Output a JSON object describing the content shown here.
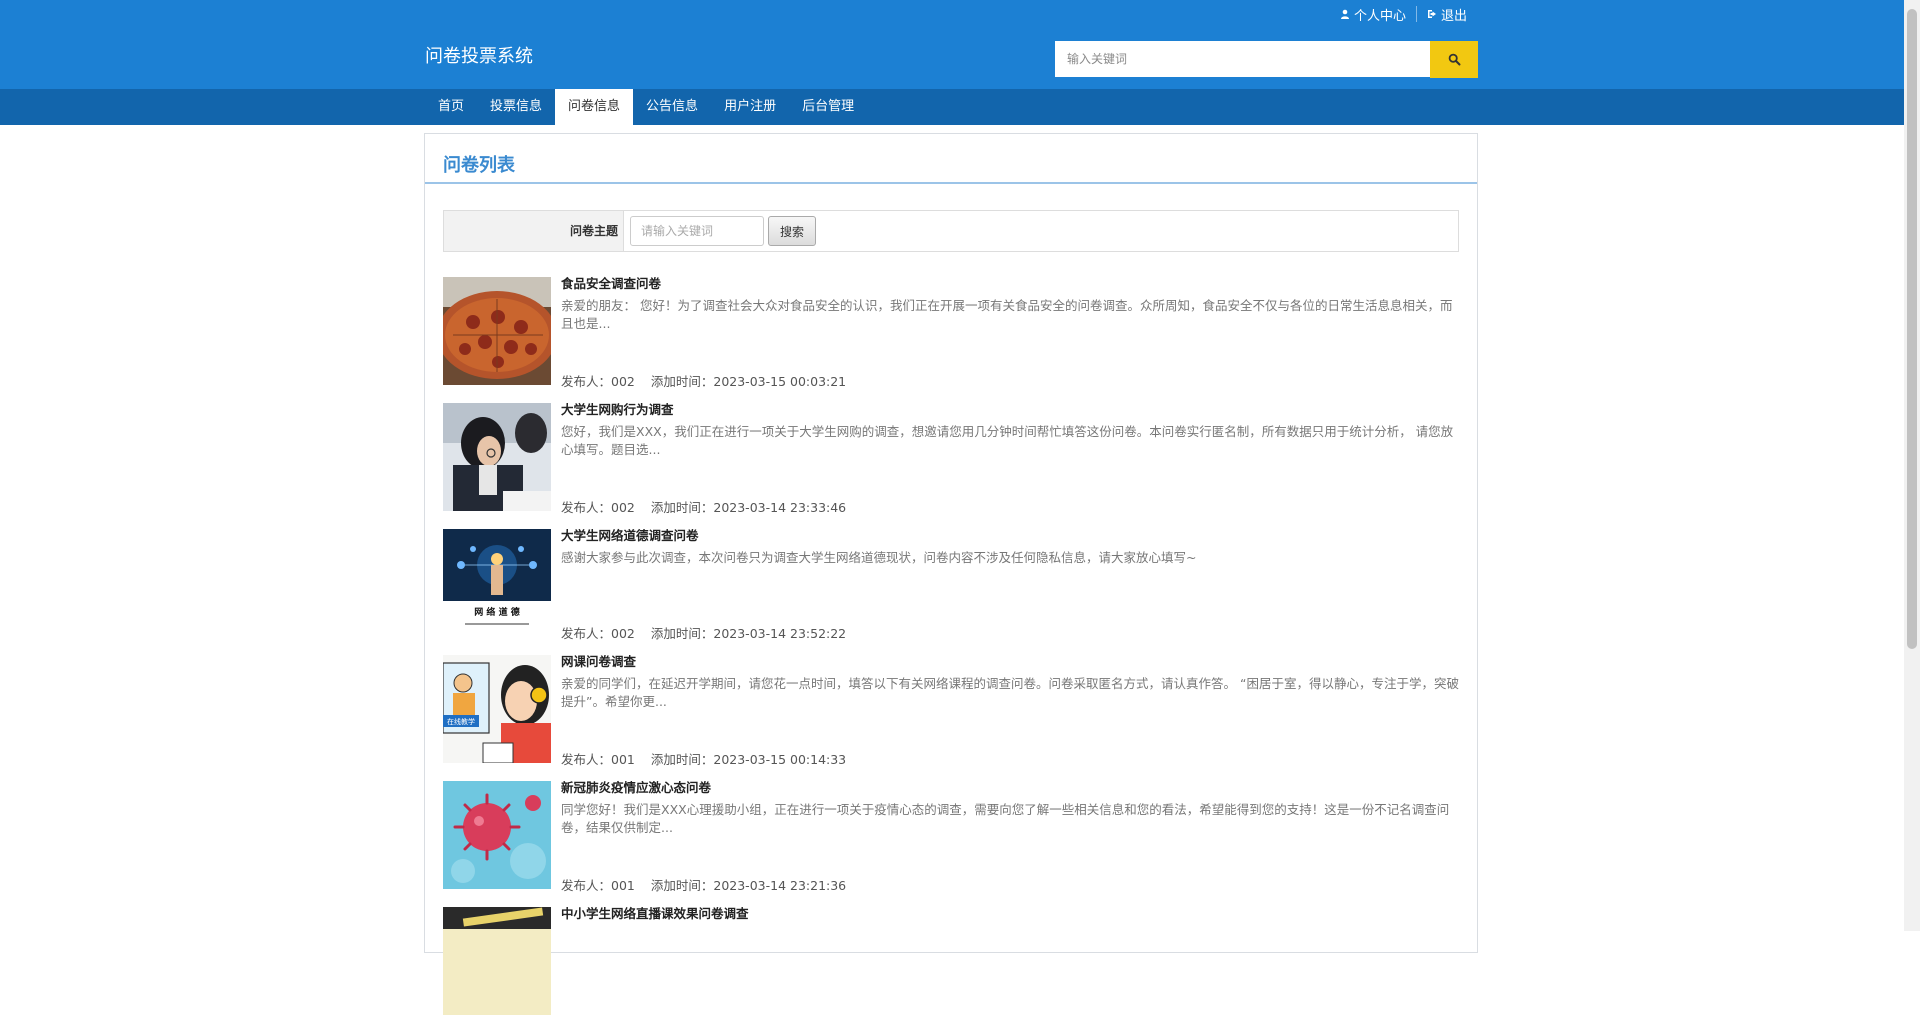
{
  "header": {
    "site_title": "问卷投票系统",
    "profile_label": "个人中心",
    "logout_label": "退出",
    "search_placeholder": "输入关键词",
    "brand_color": "#1c80d3",
    "search_button_color": "#f2c811"
  },
  "nav": {
    "items": [
      {
        "label": "首页"
      },
      {
        "label": "投票信息"
      },
      {
        "label": "问卷信息"
      },
      {
        "label": "公告信息"
      },
      {
        "label": "用户注册"
      },
      {
        "label": "后台管理"
      }
    ],
    "active_index": 2
  },
  "panel": {
    "title": "问卷列表",
    "filter_label": "问卷主题",
    "filter_placeholder": "请输入关键词",
    "filter_button": "搜索"
  },
  "list": {
    "publisher_prefix": "发布人：",
    "time_prefix": "添加时间：",
    "items": [
      {
        "title": "食品安全调查问卷",
        "desc": "亲爱的朋友： 您好！为了调查社会大众对食品安全的认识，我们正在开展一项有关食品安全的问卷调查。众所周知，食品安全不仅与各位的日常生活息息相关，而且也是...",
        "publisher": "002",
        "time": "2023-03-15 00:03:21",
        "thumb": "pizza"
      },
      {
        "title": "大学生网购行为调查",
        "desc": "您好，我们是XXX，我们正在进行一项关于大学生网购的调查，想邀请您用几分钟时间帮忙填答这份问卷。本问卷实行匿名制，所有数据只用于统计分析， 请您放心填写。题目选...",
        "publisher": "002",
        "time": "2023-03-14 23:33:46",
        "thumb": "students"
      },
      {
        "title": "大学生网络道德调查问卷",
        "desc": "感谢大家参与此次调查，本次问卷只为调查大学生网络道德现状，问卷内容不涉及任何隐私信息，请大家放心填写~",
        "publisher": "002",
        "time": "2023-03-14 23:52:22",
        "thumb": "network",
        "thumb_caption": "网 络 道 德"
      },
      {
        "title": "网课问卷调查",
        "desc": "亲爱的同学们，在延迟开学期间，请您花一点时间，填答以下有关网络课程的调查问卷。问卷采取匿名方式，请认真作答。 “困居于室，得以静心，专注于学，突破提升”。希望你更...",
        "publisher": "001",
        "time": "2023-03-15 00:14:33",
        "thumb": "online-class",
        "thumb_caption": "在线教学"
      },
      {
        "title": "新冠肺炎疫情应激心态问卷",
        "desc": "同学您好！我们是XXX心理援助小组，正在进行一项关于疫情心态的调查，需要向您了解一些相关信息和您的看法，希望能得到您的支持！这是一份不记名调查问卷，结果仅供制定...",
        "publisher": "001",
        "time": "2023-03-14 23:21:36",
        "thumb": "virus"
      },
      {
        "title": "中小学生网络直播课效果问卷调查",
        "desc": "",
        "publisher": "",
        "time": "",
        "thumb": "pen"
      }
    ]
  }
}
